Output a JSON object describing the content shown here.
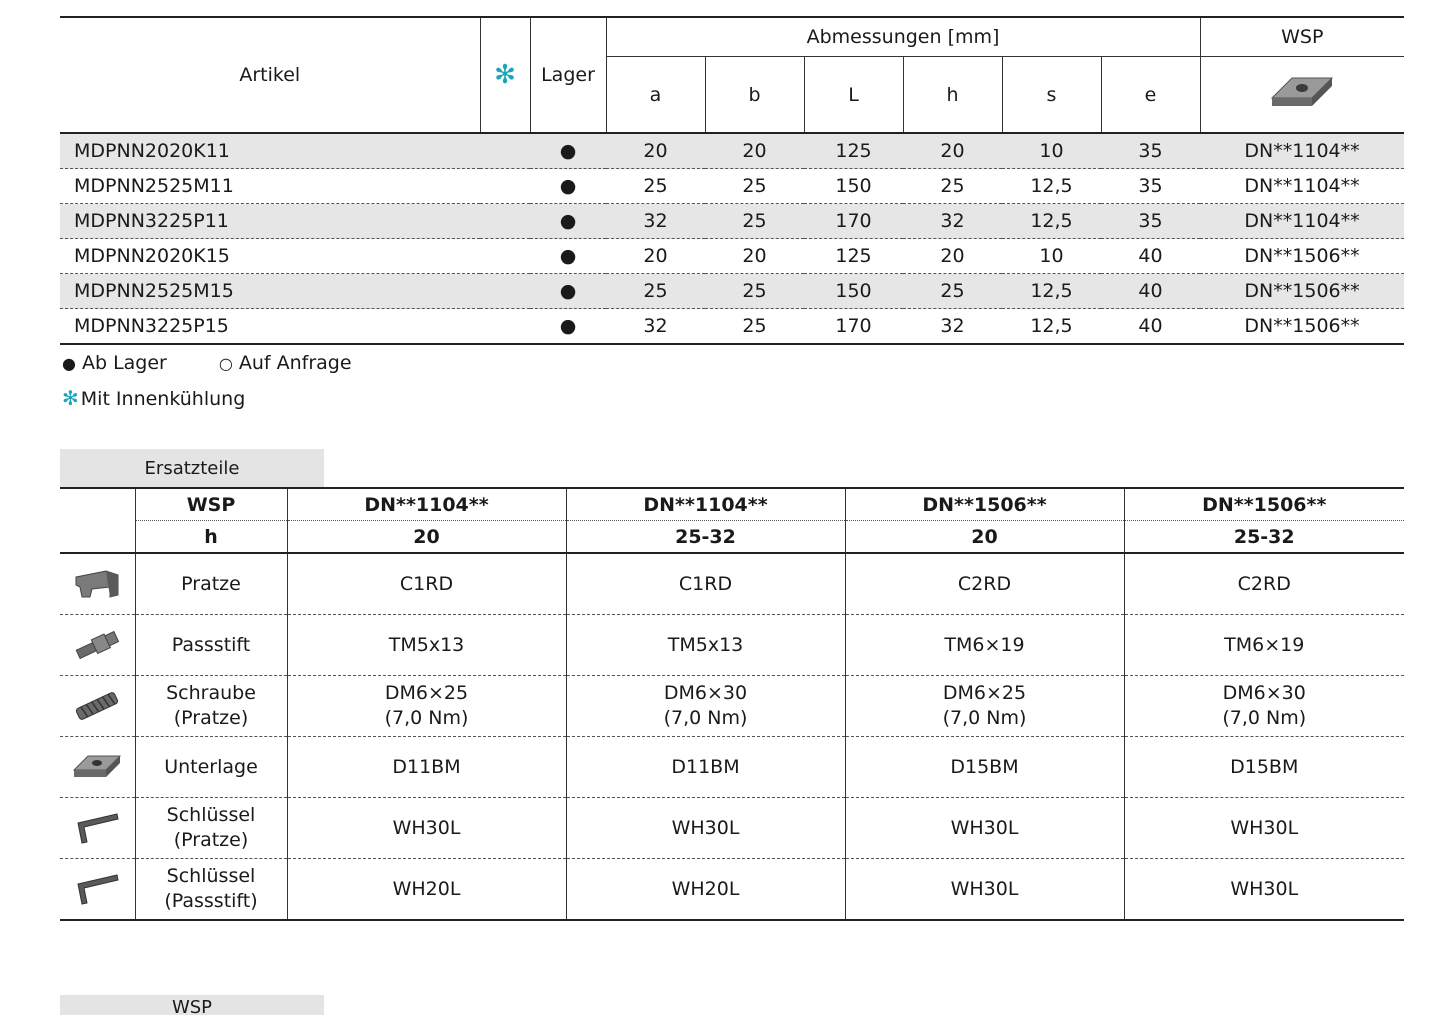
{
  "main_table": {
    "header": {
      "artikel": "Artikel",
      "cooling_symbol": "✻",
      "lager": "Lager",
      "abmessungen": "Abmessungen [mm]",
      "wsp": "WSP",
      "dims": [
        "a",
        "b",
        "L",
        "h",
        "s",
        "e"
      ]
    },
    "rows": [
      {
        "artikel": "MDPNN2020K11",
        "lager": "●",
        "a": "20",
        "b": "20",
        "L": "125",
        "h": "20",
        "s": "10",
        "e": "35",
        "wsp": "DN**1104**"
      },
      {
        "artikel": "MDPNN2525M11",
        "lager": "●",
        "a": "25",
        "b": "25",
        "L": "150",
        "h": "25",
        "s": "12,5",
        "e": "35",
        "wsp": "DN**1104**"
      },
      {
        "artikel": "MDPNN3225P11",
        "lager": "●",
        "a": "32",
        "b": "25",
        "L": "170",
        "h": "32",
        "s": "12,5",
        "e": "35",
        "wsp": "DN**1104**"
      },
      {
        "artikel": "MDPNN2020K15",
        "lager": "●",
        "a": "20",
        "b": "20",
        "L": "125",
        "h": "20",
        "s": "10",
        "e": "40",
        "wsp": "DN**1506**"
      },
      {
        "artikel": "MDPNN2525M15",
        "lager": "●",
        "a": "25",
        "b": "25",
        "L": "150",
        "h": "25",
        "s": "12,5",
        "e": "40",
        "wsp": "DN**1506**"
      },
      {
        "artikel": "MDPNN3225P15",
        "lager": "●",
        "a": "32",
        "b": "25",
        "L": "170",
        "h": "32",
        "s": "12,5",
        "e": "40",
        "wsp": "DN**1506**"
      }
    ]
  },
  "legend": {
    "ab_lager_symbol": "●",
    "ab_lager": "Ab Lager",
    "auf_anfrage_symbol": "○",
    "auf_anfrage": "Auf Anfrage",
    "cooling_symbol": "✻",
    "cooling": "Mit Innenkühlung"
  },
  "spare_parts": {
    "tab": "Ersatzteile",
    "wsp_label": "WSP",
    "h_label": "h",
    "columns": [
      {
        "wsp": "DN**1104**",
        "h": "20"
      },
      {
        "wsp": "DN**1104**",
        "h": "25-32"
      },
      {
        "wsp": "DN**1506**",
        "h": "20"
      },
      {
        "wsp": "DN**1506**",
        "h": "25-32"
      }
    ],
    "rows": [
      {
        "icon": "clamp-icon",
        "name": "Pratze",
        "sub": "",
        "values": [
          [
            "C1RD",
            ""
          ],
          [
            "C1RD",
            ""
          ],
          [
            "C2RD",
            ""
          ],
          [
            "C2RD",
            ""
          ]
        ]
      },
      {
        "icon": "pin-icon",
        "name": "Passstift",
        "sub": "",
        "values": [
          [
            "TM5x13",
            ""
          ],
          [
            "TM5x13",
            ""
          ],
          [
            "TM6×19",
            ""
          ],
          [
            "TM6×19",
            ""
          ]
        ]
      },
      {
        "icon": "screw-icon",
        "name": "Schraube",
        "sub": "(Pratze)",
        "values": [
          [
            "DM6×25",
            "(7,0 Nm)"
          ],
          [
            "DM6×30",
            "(7,0 Nm)"
          ],
          [
            "DM6×25",
            "(7,0 Nm)"
          ],
          [
            "DM6×30",
            "(7,0 Nm)"
          ]
        ]
      },
      {
        "icon": "shim-icon",
        "name": "Unterlage",
        "sub": "",
        "values": [
          [
            "D11BM",
            ""
          ],
          [
            "D11BM",
            ""
          ],
          [
            "D15BM",
            ""
          ],
          [
            "D15BM",
            ""
          ]
        ]
      },
      {
        "icon": "hex-key-icon",
        "name": "Schlüssel",
        "sub": "(Pratze)",
        "values": [
          [
            "WH30L",
            ""
          ],
          [
            "WH30L",
            ""
          ],
          [
            "WH30L",
            ""
          ],
          [
            "WH30L",
            ""
          ]
        ]
      },
      {
        "icon": "hex-key-icon",
        "name": "Schlüssel",
        "sub": "(Passstift)",
        "values": [
          [
            "WH20L",
            ""
          ],
          [
            "WH20L",
            ""
          ],
          [
            "WH30L",
            ""
          ],
          [
            "WH30L",
            ""
          ]
        ]
      }
    ]
  },
  "next_section_tab": "WSP"
}
